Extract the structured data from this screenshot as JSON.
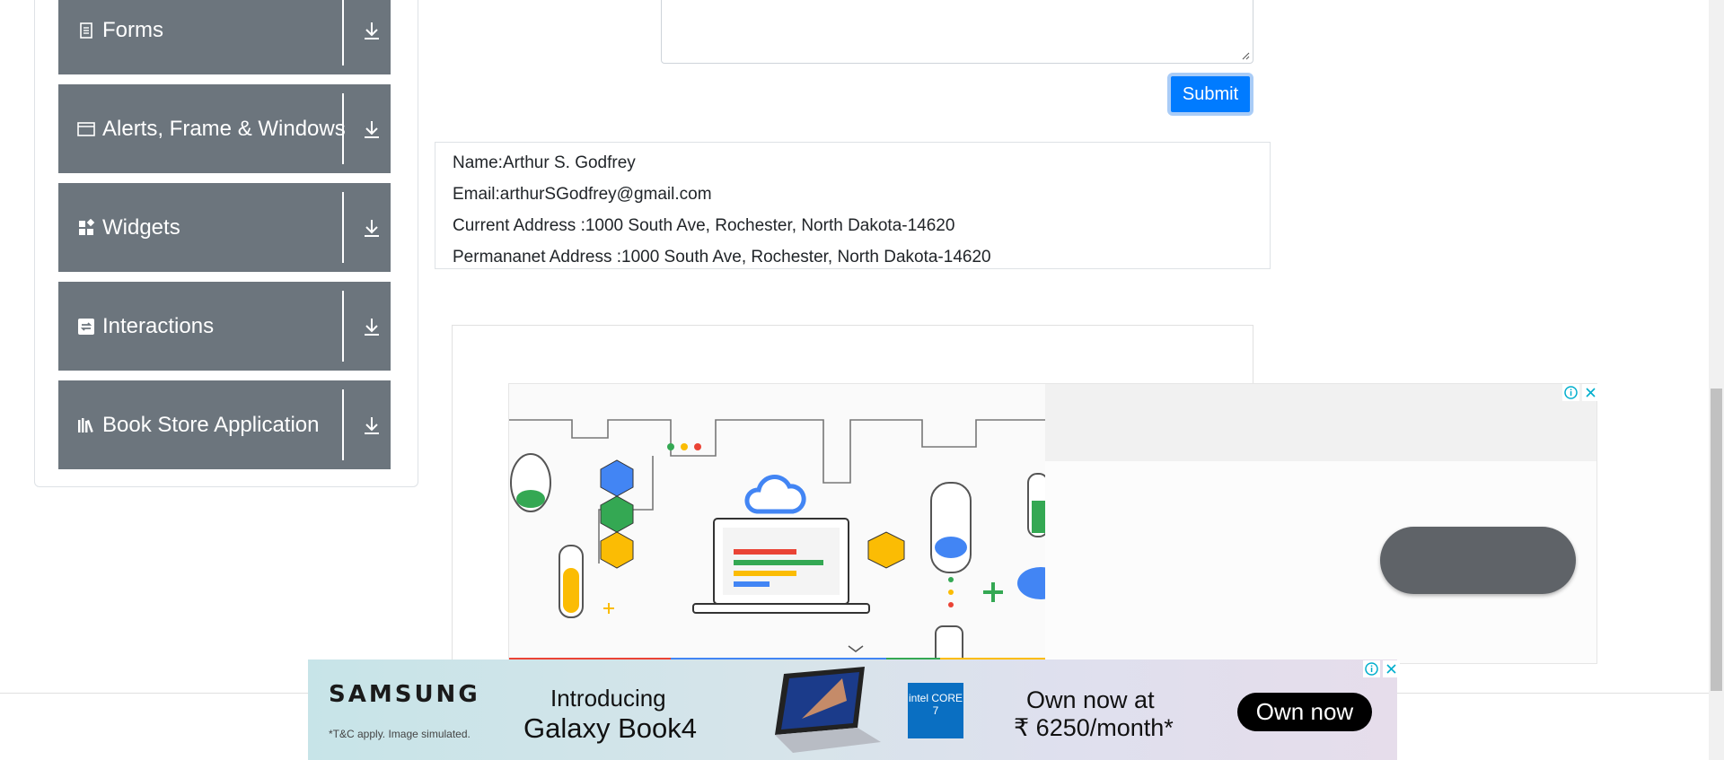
{
  "sidebar": {
    "groups": [
      {
        "label": "Forms",
        "icon": "document-icon"
      },
      {
        "label": "Alerts, Frame & Windows",
        "icon": "window-icon"
      },
      {
        "label": "Widgets",
        "icon": "widgets-icon"
      },
      {
        "label": "Interactions",
        "icon": "interactions-icon"
      },
      {
        "label": "Book Store Application",
        "icon": "books-icon"
      }
    ]
  },
  "form": {
    "submit_label": "Submit"
  },
  "output": {
    "name": "Name:Arthur S. Godfrey",
    "email": "Email:arthurSGodfrey@gmail.com",
    "current_address": "Current Address :1000 South Ave, Rochester, North Dakota-14620",
    "permanent_address": "Permananet Address :1000 South Ave, Rochester, North Dakota-14620"
  },
  "bottom_ad": {
    "brand": "SAMSUNG",
    "fine_print": "*T&C apply. Image simulated.",
    "headline_1": "Introducing",
    "headline_2": "Galaxy Book4",
    "chip_label": "intel CORE 7",
    "offer_1": "Own now at",
    "offer_2": "₹ 6250/month*",
    "cta": "Own now"
  },
  "colors": {
    "sidebar_group": "#6c757d",
    "submit": "#007bff",
    "ad_pill": "#5f6368"
  }
}
